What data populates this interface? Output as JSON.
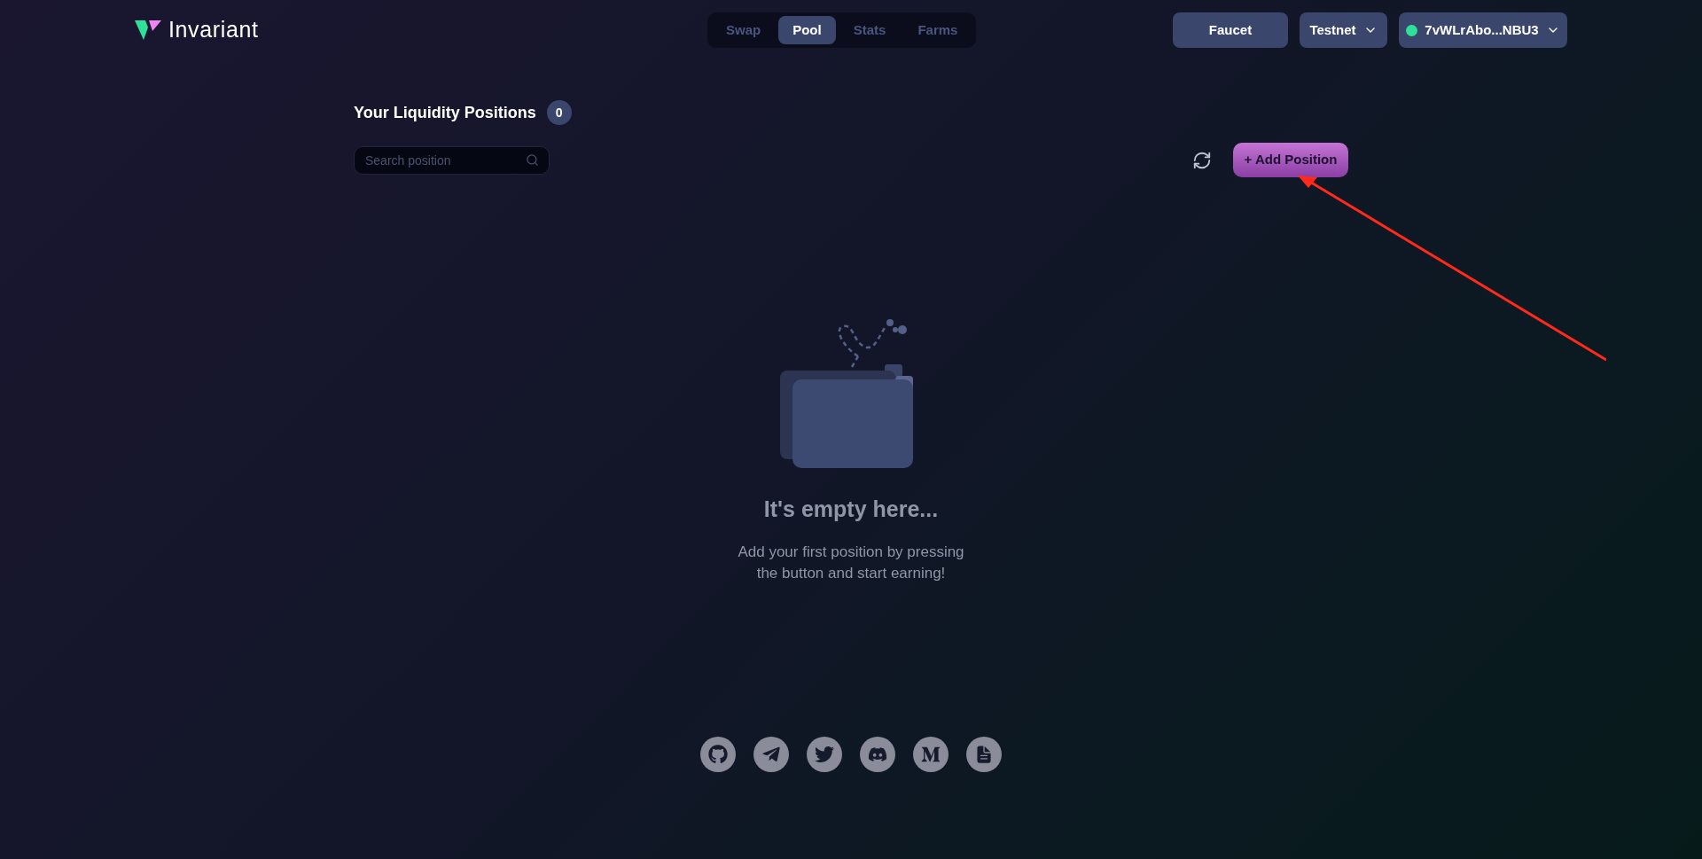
{
  "header": {
    "logo_text": "Invariant",
    "nav": [
      {
        "label": "Swap",
        "selected": false
      },
      {
        "label": "Pool",
        "selected": true
      },
      {
        "label": "Stats",
        "selected": false
      },
      {
        "label": "Farms",
        "selected": false
      }
    ],
    "faucet": "Faucet",
    "network": "Testnet",
    "wallet": {
      "address": "7vWLrAbo...NBU3",
      "connected": true
    }
  },
  "positions": {
    "title": "Your Liquidity Positions",
    "count": "0",
    "search": {
      "placeholder": "Search position"
    },
    "add_button": "+ Add Position"
  },
  "empty_state": {
    "title": "It's empty here...",
    "text": "Add your first position by pressing the button and start earning!"
  },
  "footer": {
    "links": [
      {
        "kind": "github"
      },
      {
        "kind": "telegram"
      },
      {
        "kind": "twitter"
      },
      {
        "kind": "discord"
      },
      {
        "kind": "medium"
      },
      {
        "kind": "docs"
      }
    ]
  }
}
